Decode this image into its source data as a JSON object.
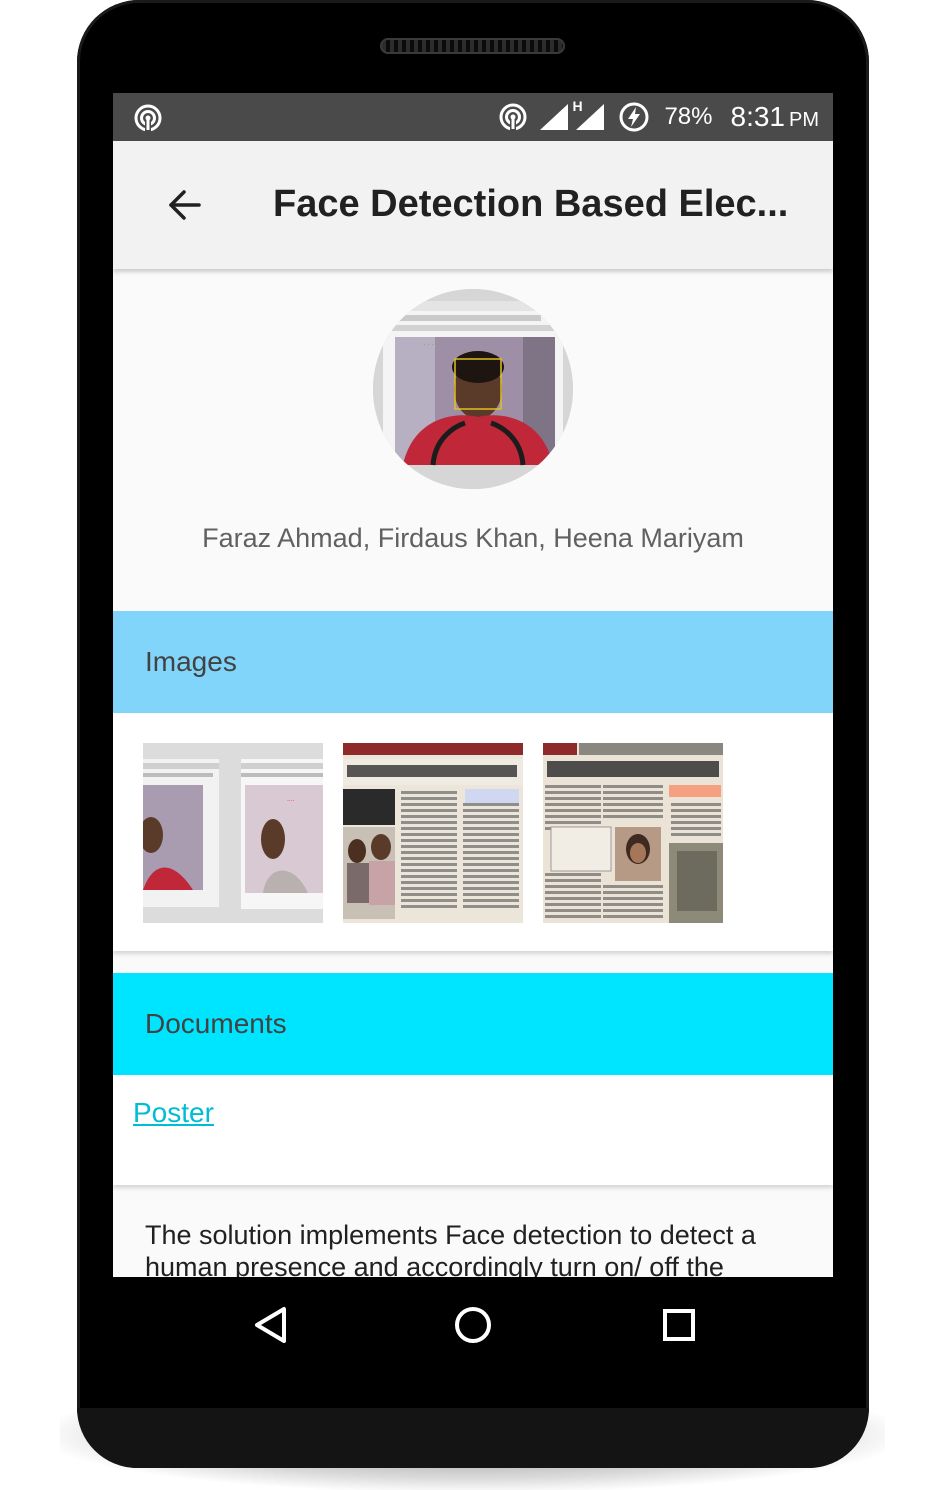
{
  "status_bar": {
    "battery_percent": "78%",
    "time": "8:31",
    "time_suffix": "PM",
    "network_type": "H",
    "icons": [
      "hotspot-icon",
      "signal-icon",
      "battery-saver-icon"
    ]
  },
  "app_bar": {
    "title": "Face Detection Based Elec...",
    "back_icon": "arrow-left-icon"
  },
  "profile": {
    "authors": "Faraz Ahmad, Firdaus Khan, Heena Mariyam"
  },
  "sections": {
    "images": {
      "label": "Images",
      "color": "#81d4fa",
      "thumbnail_count": 3
    },
    "documents": {
      "label": "Documents",
      "color": "#00e5ff",
      "links": [
        {
          "label": "Poster"
        }
      ]
    }
  },
  "description": {
    "text": "The solution implements Face detection to detect a human presence and accordingly turn on/ off the"
  },
  "nav_bar": {
    "icons": [
      "nav-back-icon",
      "nav-home-icon",
      "nav-recent-icon"
    ]
  },
  "colors": {
    "link": "#00bcd4",
    "status_bar": "#4a4a4a",
    "app_bar": "#f2f2f2"
  }
}
